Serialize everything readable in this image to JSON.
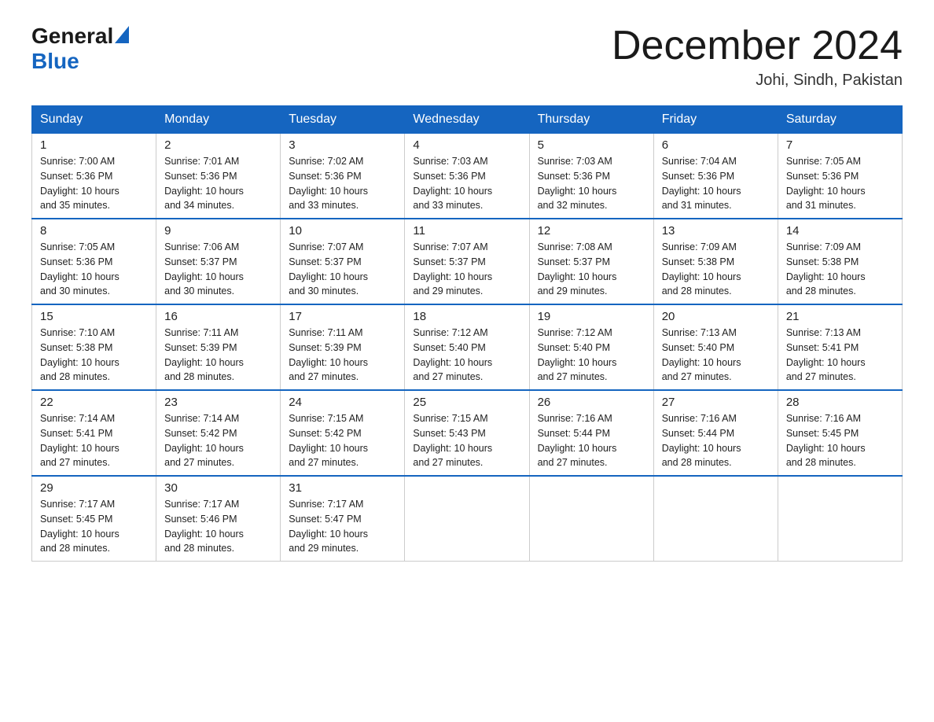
{
  "header": {
    "logo_general": "General",
    "logo_blue": "Blue",
    "title": "December 2024",
    "subtitle": "Johi, Sindh, Pakistan"
  },
  "weekdays": [
    "Sunday",
    "Monday",
    "Tuesday",
    "Wednesday",
    "Thursday",
    "Friday",
    "Saturday"
  ],
  "weeks": [
    [
      {
        "day": "1",
        "info": "Sunrise: 7:00 AM\nSunset: 5:36 PM\nDaylight: 10 hours\nand 35 minutes."
      },
      {
        "day": "2",
        "info": "Sunrise: 7:01 AM\nSunset: 5:36 PM\nDaylight: 10 hours\nand 34 minutes."
      },
      {
        "day": "3",
        "info": "Sunrise: 7:02 AM\nSunset: 5:36 PM\nDaylight: 10 hours\nand 33 minutes."
      },
      {
        "day": "4",
        "info": "Sunrise: 7:03 AM\nSunset: 5:36 PM\nDaylight: 10 hours\nand 33 minutes."
      },
      {
        "day": "5",
        "info": "Sunrise: 7:03 AM\nSunset: 5:36 PM\nDaylight: 10 hours\nand 32 minutes."
      },
      {
        "day": "6",
        "info": "Sunrise: 7:04 AM\nSunset: 5:36 PM\nDaylight: 10 hours\nand 31 minutes."
      },
      {
        "day": "7",
        "info": "Sunrise: 7:05 AM\nSunset: 5:36 PM\nDaylight: 10 hours\nand 31 minutes."
      }
    ],
    [
      {
        "day": "8",
        "info": "Sunrise: 7:05 AM\nSunset: 5:36 PM\nDaylight: 10 hours\nand 30 minutes."
      },
      {
        "day": "9",
        "info": "Sunrise: 7:06 AM\nSunset: 5:37 PM\nDaylight: 10 hours\nand 30 minutes."
      },
      {
        "day": "10",
        "info": "Sunrise: 7:07 AM\nSunset: 5:37 PM\nDaylight: 10 hours\nand 30 minutes."
      },
      {
        "day": "11",
        "info": "Sunrise: 7:07 AM\nSunset: 5:37 PM\nDaylight: 10 hours\nand 29 minutes."
      },
      {
        "day": "12",
        "info": "Sunrise: 7:08 AM\nSunset: 5:37 PM\nDaylight: 10 hours\nand 29 minutes."
      },
      {
        "day": "13",
        "info": "Sunrise: 7:09 AM\nSunset: 5:38 PM\nDaylight: 10 hours\nand 28 minutes."
      },
      {
        "day": "14",
        "info": "Sunrise: 7:09 AM\nSunset: 5:38 PM\nDaylight: 10 hours\nand 28 minutes."
      }
    ],
    [
      {
        "day": "15",
        "info": "Sunrise: 7:10 AM\nSunset: 5:38 PM\nDaylight: 10 hours\nand 28 minutes."
      },
      {
        "day": "16",
        "info": "Sunrise: 7:11 AM\nSunset: 5:39 PM\nDaylight: 10 hours\nand 28 minutes."
      },
      {
        "day": "17",
        "info": "Sunrise: 7:11 AM\nSunset: 5:39 PM\nDaylight: 10 hours\nand 27 minutes."
      },
      {
        "day": "18",
        "info": "Sunrise: 7:12 AM\nSunset: 5:40 PM\nDaylight: 10 hours\nand 27 minutes."
      },
      {
        "day": "19",
        "info": "Sunrise: 7:12 AM\nSunset: 5:40 PM\nDaylight: 10 hours\nand 27 minutes."
      },
      {
        "day": "20",
        "info": "Sunrise: 7:13 AM\nSunset: 5:40 PM\nDaylight: 10 hours\nand 27 minutes."
      },
      {
        "day": "21",
        "info": "Sunrise: 7:13 AM\nSunset: 5:41 PM\nDaylight: 10 hours\nand 27 minutes."
      }
    ],
    [
      {
        "day": "22",
        "info": "Sunrise: 7:14 AM\nSunset: 5:41 PM\nDaylight: 10 hours\nand 27 minutes."
      },
      {
        "day": "23",
        "info": "Sunrise: 7:14 AM\nSunset: 5:42 PM\nDaylight: 10 hours\nand 27 minutes."
      },
      {
        "day": "24",
        "info": "Sunrise: 7:15 AM\nSunset: 5:42 PM\nDaylight: 10 hours\nand 27 minutes."
      },
      {
        "day": "25",
        "info": "Sunrise: 7:15 AM\nSunset: 5:43 PM\nDaylight: 10 hours\nand 27 minutes."
      },
      {
        "day": "26",
        "info": "Sunrise: 7:16 AM\nSunset: 5:44 PM\nDaylight: 10 hours\nand 27 minutes."
      },
      {
        "day": "27",
        "info": "Sunrise: 7:16 AM\nSunset: 5:44 PM\nDaylight: 10 hours\nand 28 minutes."
      },
      {
        "day": "28",
        "info": "Sunrise: 7:16 AM\nSunset: 5:45 PM\nDaylight: 10 hours\nand 28 minutes."
      }
    ],
    [
      {
        "day": "29",
        "info": "Sunrise: 7:17 AM\nSunset: 5:45 PM\nDaylight: 10 hours\nand 28 minutes."
      },
      {
        "day": "30",
        "info": "Sunrise: 7:17 AM\nSunset: 5:46 PM\nDaylight: 10 hours\nand 28 minutes."
      },
      {
        "day": "31",
        "info": "Sunrise: 7:17 AM\nSunset: 5:47 PM\nDaylight: 10 hours\nand 29 minutes."
      },
      null,
      null,
      null,
      null
    ]
  ]
}
